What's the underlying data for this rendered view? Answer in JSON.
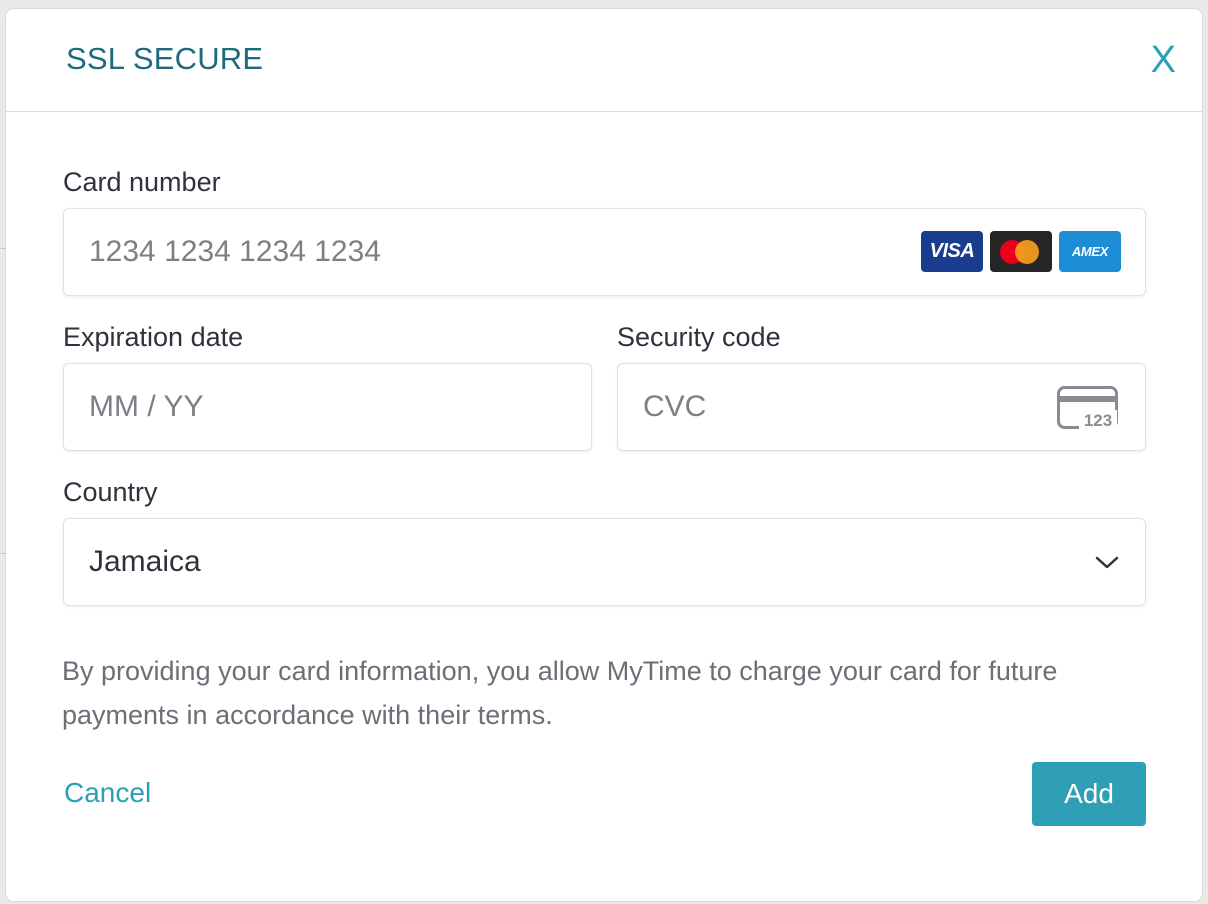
{
  "modal": {
    "title": "SSL SECURE",
    "close_label": "X"
  },
  "card_number": {
    "label": "Card number",
    "placeholder": "1234 1234 1234 1234",
    "value": "",
    "brands": [
      "visa",
      "mastercard",
      "amex"
    ],
    "visa_text": "VISA",
    "amex_text": "AMEX"
  },
  "expiration": {
    "label": "Expiration date",
    "placeholder": "MM / YY",
    "value": ""
  },
  "security_code": {
    "label": "Security code",
    "placeholder": "CVC",
    "value": "",
    "icon_text": "123"
  },
  "country": {
    "label": "Country",
    "selected": "Jamaica"
  },
  "disclaimer": "By providing your card information, you allow MyTime to charge your card for future payments in accordance with their terms.",
  "actions": {
    "cancel_label": "Cancel",
    "add_label": "Add"
  },
  "colors": {
    "accent": "#2aa0b8",
    "title": "#1e6a7e",
    "button_bg": "#2e9fb5",
    "text": "#30313d",
    "muted": "#6d6e78"
  }
}
